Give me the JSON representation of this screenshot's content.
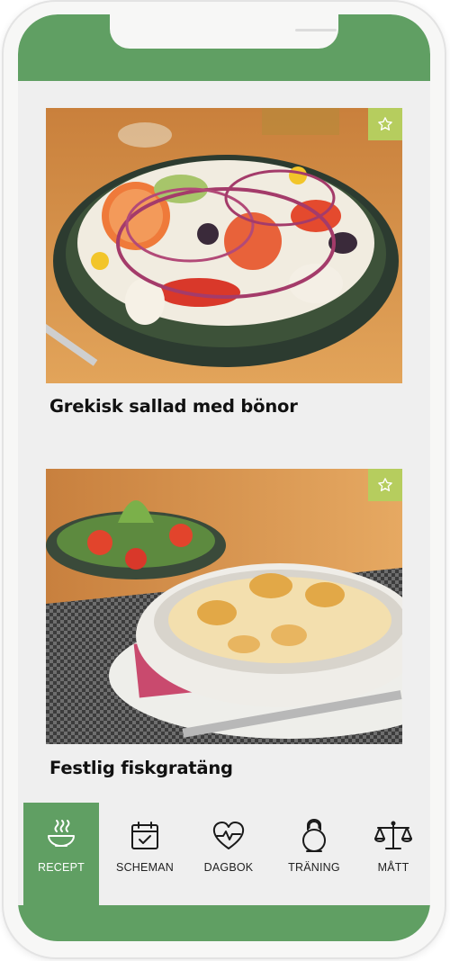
{
  "recipes": [
    {
      "title": "Grekisk sallad med bönor",
      "favorite_icon": "star-outline-icon"
    },
    {
      "title": "Festlig fiskgratäng",
      "favorite_icon": "star-outline-icon"
    }
  ],
  "nav": {
    "items": [
      {
        "label": "RECEPT",
        "icon": "bowl-icon",
        "active": true
      },
      {
        "label": "SCHEMAN",
        "icon": "calendar-check-icon",
        "active": false
      },
      {
        "label": "DAGBOK",
        "icon": "heart-pulse-icon",
        "active": false
      },
      {
        "label": "TRÄNING",
        "icon": "kettlebell-icon",
        "active": false
      },
      {
        "label": "MÅTT",
        "icon": "scale-icon",
        "active": false
      }
    ]
  },
  "colors": {
    "brand_green": "#609f63",
    "favorite_badge": "#b6cd5e",
    "background": "#efefef"
  }
}
